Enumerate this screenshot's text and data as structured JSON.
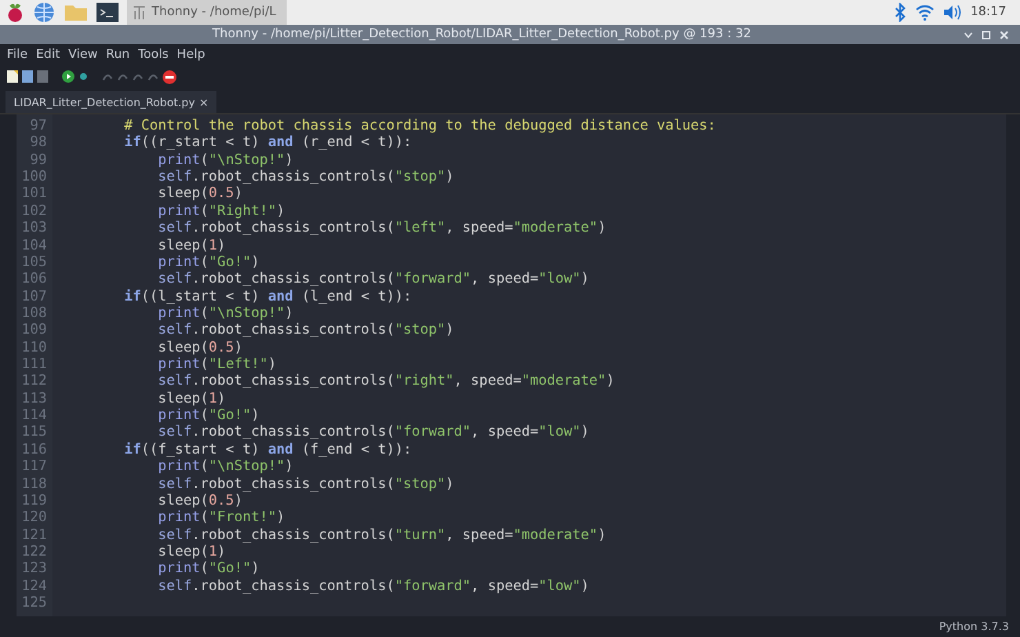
{
  "taskbar": {
    "window_button": "Thonny - /home/pi/L",
    "clock": "18:17"
  },
  "window": {
    "title": "Thonny - /home/pi/Litter_Detection_Robot/LIDAR_Litter_Detection_Robot.py  @  193 : 32"
  },
  "menu": [
    "File",
    "Edit",
    "View",
    "Run",
    "Tools",
    "Help"
  ],
  "tabs": [
    {
      "label": "LIDAR_Litter_Detection_Robot.py",
      "selected": true,
      "close": "×"
    }
  ],
  "editor": {
    "lines": [
      {
        "number": "97",
        "tokens": [
          {
            "kind": "comment",
            "text": "        # Control the robot chassis according to the debugged distance values:"
          }
        ]
      },
      {
        "number": "98",
        "tokens": [
          {
            "kind": "keyword",
            "text": "        if"
          },
          {
            "kind": "plain",
            "text": "((r_start < t) "
          },
          {
            "kind": "keyword",
            "text": "and"
          },
          {
            "kind": "plain",
            "text": " (r_end < t)):"
          }
        ]
      },
      {
        "number": "99",
        "tokens": [
          {
            "kind": "builtin",
            "text": "            print"
          },
          {
            "kind": "plain",
            "text": "("
          },
          {
            "kind": "string",
            "text": "\"\\nStop!\""
          },
          {
            "kind": "plain",
            "text": ")"
          }
        ]
      },
      {
        "number": "100",
        "tokens": [
          {
            "kind": "self",
            "text": "            self"
          },
          {
            "kind": "plain",
            "text": ".robot_chassis_controls("
          },
          {
            "kind": "string",
            "text": "\"stop\""
          },
          {
            "kind": "plain",
            "text": ")"
          }
        ]
      },
      {
        "number": "101",
        "tokens": [
          {
            "kind": "plain",
            "text": "            sleep("
          },
          {
            "kind": "number",
            "text": "0.5"
          },
          {
            "kind": "plain",
            "text": ")"
          }
        ]
      },
      {
        "number": "102",
        "tokens": [
          {
            "kind": "builtin",
            "text": "            print"
          },
          {
            "kind": "plain",
            "text": "("
          },
          {
            "kind": "string",
            "text": "\"Right!\""
          },
          {
            "kind": "plain",
            "text": ")"
          }
        ]
      },
      {
        "number": "103",
        "tokens": [
          {
            "kind": "self",
            "text": "            self"
          },
          {
            "kind": "plain",
            "text": ".robot_chassis_controls("
          },
          {
            "kind": "string",
            "text": "\"left\""
          },
          {
            "kind": "plain",
            "text": ", speed="
          },
          {
            "kind": "string",
            "text": "\"moderate\""
          },
          {
            "kind": "plain",
            "text": ")"
          }
        ]
      },
      {
        "number": "104",
        "tokens": [
          {
            "kind": "plain",
            "text": "            sleep("
          },
          {
            "kind": "number",
            "text": "1"
          },
          {
            "kind": "plain",
            "text": ")"
          }
        ]
      },
      {
        "number": "105",
        "tokens": [
          {
            "kind": "builtin",
            "text": "            print"
          },
          {
            "kind": "plain",
            "text": "("
          },
          {
            "kind": "string",
            "text": "\"Go!\""
          },
          {
            "kind": "plain",
            "text": ")"
          }
        ]
      },
      {
        "number": "106",
        "tokens": [
          {
            "kind": "self",
            "text": "            self"
          },
          {
            "kind": "plain",
            "text": ".robot_chassis_controls("
          },
          {
            "kind": "string",
            "text": "\"forward\""
          },
          {
            "kind": "plain",
            "text": ", speed="
          },
          {
            "kind": "string",
            "text": "\"low\""
          },
          {
            "kind": "plain",
            "text": ")"
          }
        ]
      },
      {
        "number": "107",
        "tokens": [
          {
            "kind": "keyword",
            "text": "        if"
          },
          {
            "kind": "plain",
            "text": "((l_start < t) "
          },
          {
            "kind": "keyword",
            "text": "and"
          },
          {
            "kind": "plain",
            "text": " (l_end < t)):"
          }
        ]
      },
      {
        "number": "108",
        "tokens": [
          {
            "kind": "builtin",
            "text": "            print"
          },
          {
            "kind": "plain",
            "text": "("
          },
          {
            "kind": "string",
            "text": "\"\\nStop!\""
          },
          {
            "kind": "plain",
            "text": ")"
          }
        ]
      },
      {
        "number": "109",
        "tokens": [
          {
            "kind": "self",
            "text": "            self"
          },
          {
            "kind": "plain",
            "text": ".robot_chassis_controls("
          },
          {
            "kind": "string",
            "text": "\"stop\""
          },
          {
            "kind": "plain",
            "text": ")"
          }
        ]
      },
      {
        "number": "110",
        "tokens": [
          {
            "kind": "plain",
            "text": "            sleep("
          },
          {
            "kind": "number",
            "text": "0.5"
          },
          {
            "kind": "plain",
            "text": ")"
          }
        ]
      },
      {
        "number": "111",
        "tokens": [
          {
            "kind": "builtin",
            "text": "            print"
          },
          {
            "kind": "plain",
            "text": "("
          },
          {
            "kind": "string",
            "text": "\"Left!\""
          },
          {
            "kind": "plain",
            "text": ")"
          }
        ]
      },
      {
        "number": "112",
        "tokens": [
          {
            "kind": "self",
            "text": "            self"
          },
          {
            "kind": "plain",
            "text": ".robot_chassis_controls("
          },
          {
            "kind": "string",
            "text": "\"right\""
          },
          {
            "kind": "plain",
            "text": ", speed="
          },
          {
            "kind": "string",
            "text": "\"moderate\""
          },
          {
            "kind": "plain",
            "text": ")"
          }
        ]
      },
      {
        "number": "113",
        "tokens": [
          {
            "kind": "plain",
            "text": "            sleep("
          },
          {
            "kind": "number",
            "text": "1"
          },
          {
            "kind": "plain",
            "text": ")"
          }
        ]
      },
      {
        "number": "114",
        "tokens": [
          {
            "kind": "builtin",
            "text": "            print"
          },
          {
            "kind": "plain",
            "text": "("
          },
          {
            "kind": "string",
            "text": "\"Go!\""
          },
          {
            "kind": "plain",
            "text": ")"
          }
        ]
      },
      {
        "number": "115",
        "tokens": [
          {
            "kind": "self",
            "text": "            self"
          },
          {
            "kind": "plain",
            "text": ".robot_chassis_controls("
          },
          {
            "kind": "string",
            "text": "\"forward\""
          },
          {
            "kind": "plain",
            "text": ", speed="
          },
          {
            "kind": "string",
            "text": "\"low\""
          },
          {
            "kind": "plain",
            "text": ")"
          }
        ]
      },
      {
        "number": "116",
        "tokens": [
          {
            "kind": "keyword",
            "text": "        if"
          },
          {
            "kind": "plain",
            "text": "((f_start < t) "
          },
          {
            "kind": "keyword",
            "text": "and"
          },
          {
            "kind": "plain",
            "text": " (f_end < t)):"
          }
        ]
      },
      {
        "number": "117",
        "tokens": [
          {
            "kind": "builtin",
            "text": "            print"
          },
          {
            "kind": "plain",
            "text": "("
          },
          {
            "kind": "string",
            "text": "\"\\nStop!\""
          },
          {
            "kind": "plain",
            "text": ")"
          }
        ]
      },
      {
        "number": "118",
        "tokens": [
          {
            "kind": "self",
            "text": "            self"
          },
          {
            "kind": "plain",
            "text": ".robot_chassis_controls("
          },
          {
            "kind": "string",
            "text": "\"stop\""
          },
          {
            "kind": "plain",
            "text": ")"
          }
        ]
      },
      {
        "number": "119",
        "tokens": [
          {
            "kind": "plain",
            "text": "            sleep("
          },
          {
            "kind": "number",
            "text": "0.5"
          },
          {
            "kind": "plain",
            "text": ")"
          }
        ]
      },
      {
        "number": "120",
        "tokens": [
          {
            "kind": "builtin",
            "text": "            print"
          },
          {
            "kind": "plain",
            "text": "("
          },
          {
            "kind": "string",
            "text": "\"Front!\""
          },
          {
            "kind": "plain",
            "text": ")"
          }
        ]
      },
      {
        "number": "121",
        "tokens": [
          {
            "kind": "self",
            "text": "            self"
          },
          {
            "kind": "plain",
            "text": ".robot_chassis_controls("
          },
          {
            "kind": "string",
            "text": "\"turn\""
          },
          {
            "kind": "plain",
            "text": ", speed="
          },
          {
            "kind": "string",
            "text": "\"moderate\""
          },
          {
            "kind": "plain",
            "text": ")"
          }
        ]
      },
      {
        "number": "122",
        "tokens": [
          {
            "kind": "plain",
            "text": "            sleep("
          },
          {
            "kind": "number",
            "text": "1"
          },
          {
            "kind": "plain",
            "text": ")"
          }
        ]
      },
      {
        "number": "123",
        "tokens": [
          {
            "kind": "builtin",
            "text": "            print"
          },
          {
            "kind": "plain",
            "text": "("
          },
          {
            "kind": "string",
            "text": "\"Go!\""
          },
          {
            "kind": "plain",
            "text": ")"
          }
        ]
      },
      {
        "number": "124",
        "tokens": [
          {
            "kind": "self",
            "text": "            self"
          },
          {
            "kind": "plain",
            "text": ".robot_chassis_controls("
          },
          {
            "kind": "string",
            "text": "\"forward\""
          },
          {
            "kind": "plain",
            "text": ", speed="
          },
          {
            "kind": "string",
            "text": "\"low\""
          },
          {
            "kind": "plain",
            "text": ")"
          }
        ]
      },
      {
        "number": "125"
      }
    ]
  },
  "status_bar": {
    "text": "Python 3.7.3"
  }
}
